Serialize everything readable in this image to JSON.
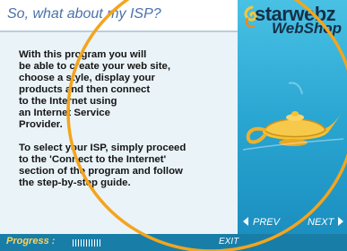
{
  "title": "So, what about my ISP?",
  "body": {
    "paragraphs": [
      "With this program you will\nbe able to create your web site,\nchoose a style, display your\nproducts and then connect\nto the Internet using\nan Internet Service\nProvider.",
      "To select your ISP, simply proceed\nto the 'Connect to the Internet'\nsection of the program and follow\nthe step-by-step guide."
    ]
  },
  "brand": {
    "line1": "starwebz",
    "line2": "WebShop"
  },
  "nav": {
    "prev_label": "PREV",
    "next_label": "NEXT"
  },
  "footer": {
    "progress_label": "Progress :",
    "exit_label": "EXIT"
  },
  "icons": [
    "starwebz-logo-swirl-icon",
    "magic-lamp-icon",
    "arrow-left-icon",
    "arrow-right-icon"
  ],
  "colors": {
    "title": "#4a72a8",
    "panel_bg": "#eaf3f8",
    "brand_blue": "#2aa6d2",
    "bottom_bar": "#187ea8",
    "progress_text": "#ffd25a",
    "ring": "#f4a51c"
  }
}
